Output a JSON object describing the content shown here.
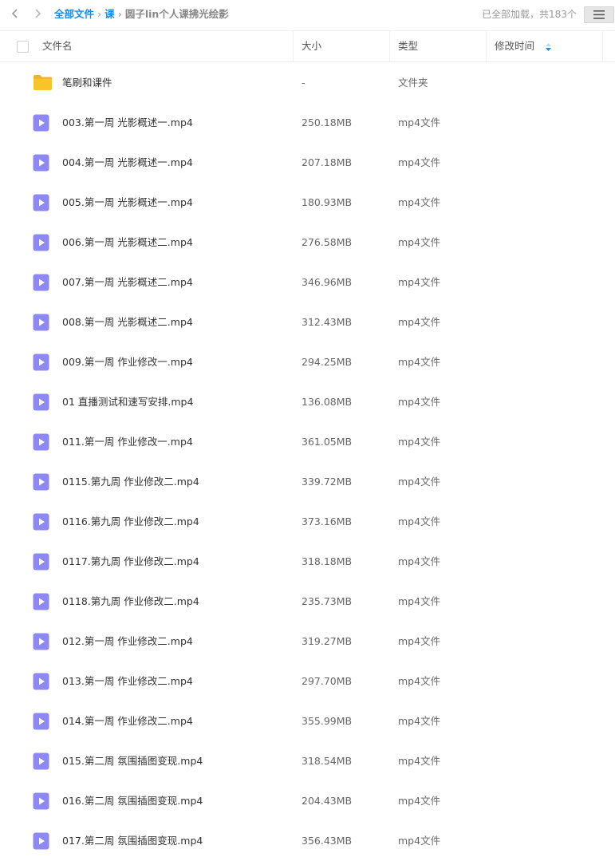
{
  "nav": {
    "back_icon": "chevron-left-icon",
    "forward_icon": "chevron-right-icon"
  },
  "breadcrumb": {
    "root": "全部文件",
    "level1": "课",
    "current": "圆子lin个人课拂光绘影",
    "separator": "›"
  },
  "status": "已全部加载，共183个",
  "menu_icon": "list-menu-icon",
  "colors": {
    "link": "#1a8ceb",
    "folder": "#f8c42b",
    "video": "#8e88f2"
  },
  "columns": {
    "name": "文件名",
    "size": "大小",
    "type": "类型",
    "modified": "修改时间"
  },
  "files": [
    {
      "name": "笔刷和课件",
      "size": "-",
      "type": "文件夹",
      "icon": "folder-icon"
    },
    {
      "name": "003.第一周 光影概述一.mp4",
      "size": "250.18MB",
      "type": "mp4文件",
      "icon": "video-file-icon"
    },
    {
      "name": "004.第一周 光影概述一.mp4",
      "size": "207.18MB",
      "type": "mp4文件",
      "icon": "video-file-icon"
    },
    {
      "name": "005.第一周 光影概述一.mp4",
      "size": "180.93MB",
      "type": "mp4文件",
      "icon": "video-file-icon"
    },
    {
      "name": "006.第一周 光影概述二.mp4",
      "size": "276.58MB",
      "type": "mp4文件",
      "icon": "video-file-icon"
    },
    {
      "name": "007.第一周 光影概述二.mp4",
      "size": "346.96MB",
      "type": "mp4文件",
      "icon": "video-file-icon"
    },
    {
      "name": "008.第一周 光影概述二.mp4",
      "size": "312.43MB",
      "type": "mp4文件",
      "icon": "video-file-icon"
    },
    {
      "name": "009.第一周 作业修改一.mp4",
      "size": "294.25MB",
      "type": "mp4文件",
      "icon": "video-file-icon"
    },
    {
      "name": "01 直播测试和速写安排.mp4",
      "size": "136.08MB",
      "type": "mp4文件",
      "icon": "video-file-icon"
    },
    {
      "name": "011.第一周 作业修改一.mp4",
      "size": "361.05MB",
      "type": "mp4文件",
      "icon": "video-file-icon"
    },
    {
      "name": "0115.第九周 作业修改二.mp4",
      "size": "339.72MB",
      "type": "mp4文件",
      "icon": "video-file-icon"
    },
    {
      "name": "0116.第九周 作业修改二.mp4",
      "size": "373.16MB",
      "type": "mp4文件",
      "icon": "video-file-icon"
    },
    {
      "name": "0117.第九周 作业修改二.mp4",
      "size": "318.18MB",
      "type": "mp4文件",
      "icon": "video-file-icon"
    },
    {
      "name": "0118.第九周 作业修改二.mp4",
      "size": "235.73MB",
      "type": "mp4文件",
      "icon": "video-file-icon"
    },
    {
      "name": "012.第一周 作业修改二.mp4",
      "size": "319.27MB",
      "type": "mp4文件",
      "icon": "video-file-icon"
    },
    {
      "name": "013.第一周 作业修改二.mp4",
      "size": "297.70MB",
      "type": "mp4文件",
      "icon": "video-file-icon"
    },
    {
      "name": "014.第一周 作业修改二.mp4",
      "size": "355.99MB",
      "type": "mp4文件",
      "icon": "video-file-icon"
    },
    {
      "name": "015.第二周 氛围插图变现.mp4",
      "size": "318.54MB",
      "type": "mp4文件",
      "icon": "video-file-icon"
    },
    {
      "name": "016.第二周 氛围插图变现.mp4",
      "size": "204.43MB",
      "type": "mp4文件",
      "icon": "video-file-icon"
    },
    {
      "name": "017.第二周 氛围插图变现.mp4",
      "size": "356.43MB",
      "type": "mp4文件",
      "icon": "video-file-icon"
    }
  ]
}
